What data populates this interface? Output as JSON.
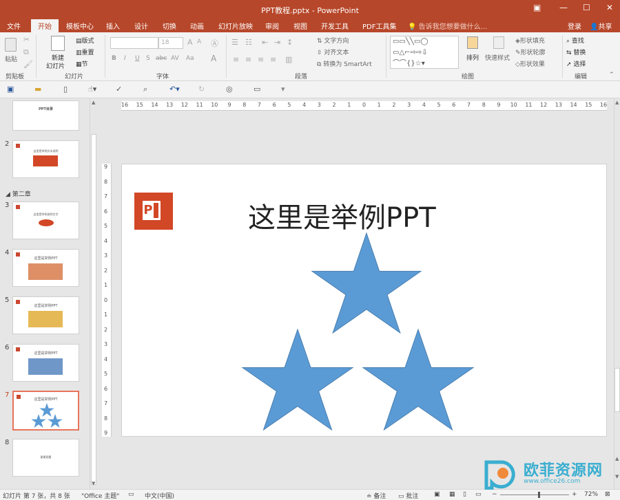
{
  "window": {
    "title": "PPT教程.pptx - PowerPoint",
    "controls": [
      "▣",
      "—",
      "☐",
      "✕"
    ]
  },
  "tabs": [
    "文件",
    "开始",
    "模板中心",
    "插入",
    "设计",
    "切换",
    "动画",
    "幻灯片放映",
    "审阅",
    "视图",
    "开发工具",
    "PDF工具集"
  ],
  "tell_me": "告诉我您想要做什么...",
  "account": {
    "login": "登录",
    "share": "共享"
  },
  "ribbon": {
    "groups": [
      "剪贴板",
      "幻灯片",
      "字体",
      "段落",
      "绘图",
      "编辑"
    ],
    "clipboard": {
      "paste": "粘贴"
    },
    "slides": {
      "new_slide_line1": "新建",
      "new_slide_line2": "幻灯片",
      "layout": "版式",
      "reset": "重置",
      "section": "节"
    },
    "font": {
      "name_value": "",
      "size_value": "18",
      "bold": "B",
      "italic": "I",
      "underline": "U",
      "shadow": "S",
      "strike": "abc",
      "spacing": "AV",
      "case": "Aa",
      "color": "A"
    },
    "paragraph": {
      "text_direction": "文字方向",
      "align_text": "对齐文本",
      "smartart": "转换为 SmartArt"
    },
    "drawing": {
      "arrange": "排列",
      "quick_styles": "快速样式",
      "shape_fill": "形状填充",
      "shape_outline": "形状轮廓",
      "shape_effects": "形状效果"
    },
    "editing": {
      "find": "查找",
      "replace": "替换",
      "select": "选择"
    }
  },
  "sections": [
    "第二章"
  ],
  "thumbnails": [
    {
      "num": "",
      "title": "PPT目录"
    },
    {
      "num": "2",
      "title": "这里是举例文本说明"
    },
    {
      "num": "3",
      "title": "这里是举例说明文字"
    },
    {
      "num": "4",
      "title": "这里是举例PPT"
    },
    {
      "num": "5",
      "title": "这里是举例PPT"
    },
    {
      "num": "6",
      "title": "这里是举例PPT"
    },
    {
      "num": "7",
      "title": "这里是举例PPT"
    },
    {
      "num": "8",
      "title": "谢谢观看"
    }
  ],
  "slide": {
    "title": "这里是举例PPT",
    "star_color": "#5b9bd5",
    "logo_color": "#d24726"
  },
  "ruler": {
    "h_labels": [
      "16",
      "15",
      "14",
      "13",
      "12",
      "11",
      "10",
      "9",
      "8",
      "7",
      "6",
      "5",
      "4",
      "3",
      "2",
      "1",
      "0",
      "1",
      "2",
      "3",
      "4",
      "5",
      "6",
      "7",
      "8",
      "9",
      "10",
      "11",
      "12",
      "13",
      "14",
      "15",
      "16"
    ],
    "v_labels": [
      "9",
      "8",
      "7",
      "6",
      "5",
      "4",
      "3",
      "2",
      "1",
      "0",
      "1",
      "2",
      "3",
      "4",
      "5",
      "6",
      "7",
      "8",
      "9"
    ]
  },
  "status": {
    "slide_info": "幻灯片 第 7 张，共 8 张",
    "theme": "\"Office 主题\"",
    "language": "中文(中国)",
    "notes": "备注",
    "comments": "批注",
    "zoom": "72%"
  },
  "watermark": {
    "brand": "欧菲资源网",
    "url": "www.office26.com"
  },
  "colors": {
    "accent": "#b7472a",
    "selected": "#e8735a"
  }
}
